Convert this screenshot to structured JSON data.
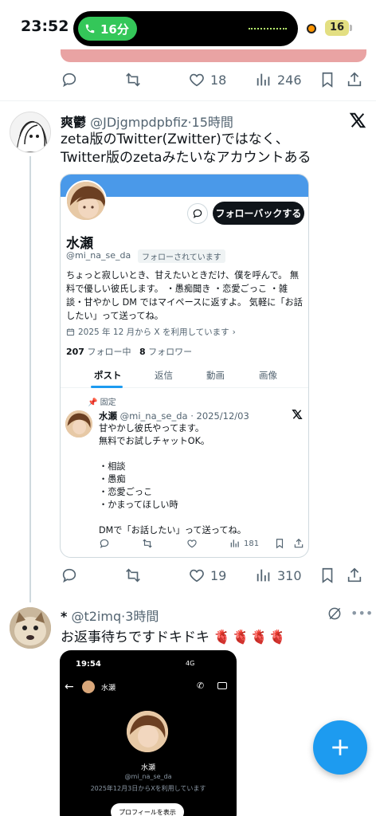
{
  "status_bar": {
    "time": "23:52",
    "call_duration": "16分",
    "battery": "16"
  },
  "prev_post": {
    "likes": "18",
    "views": "246"
  },
  "post1": {
    "display_name": "爽鬱",
    "handle": "@JDjgmpdpbfiz",
    "time": "15時間",
    "text_line1": "zeta版のTwitter(Zwitter)ではなく、",
    "text_line2": "Twitter版のzetaみたいなアカウントある",
    "likes": "19",
    "views": "310"
  },
  "profile_card": {
    "follow_back_label": "フォローバックする",
    "name": "水瀬",
    "handle": "@mi_na_se_da",
    "follows_you": "フォローされています",
    "bio": "ちょっと寂しいとき、甘えたいときだけ、僕を呼んで。 無料で優しい彼氏します。 ・愚痴聞き ・恋愛ごっこ ・雑談・甘やかし DM ではマイペースに返すよ。 気軽に「お話したい」って送ってね。",
    "joined": "2025 年 12 月から X を利用しています",
    "following_count": "207",
    "following_label": "フォロー中",
    "followers_count": "8",
    "followers_label": "フォロワー",
    "tabs": [
      "ポスト",
      "返信",
      "動画",
      "画像"
    ],
    "pinned_label": "固定",
    "pinned_post": {
      "name": "水瀬",
      "handle": "@mi_na_se_da",
      "date": "2025/12/03",
      "text": "甘やかし彼氏やってます。\n無料でお試しチャットOK。\n\n・相談\n・愚痴\n・恋愛ごっこ\n・かまってほしい時\n\nDMで「お話したい」って送ってね。",
      "views": "181"
    }
  },
  "post2": {
    "display_name": "*",
    "handle": "@t2imq",
    "time": "3時間",
    "text": "お返事待ちですドキドキ",
    "hearts": "🫀🫀🫀🫀"
  },
  "screenshot": {
    "time": "19:54",
    "network": "4G",
    "name": "水瀬",
    "handle": "@mi_na_se_da",
    "joined": "2025年12月3日からXを利用しています",
    "button": "プロフィールを表示"
  },
  "colors": {
    "accent": "#1d9bf0",
    "banner": "#4a99e9",
    "call_green": "#34c759"
  }
}
